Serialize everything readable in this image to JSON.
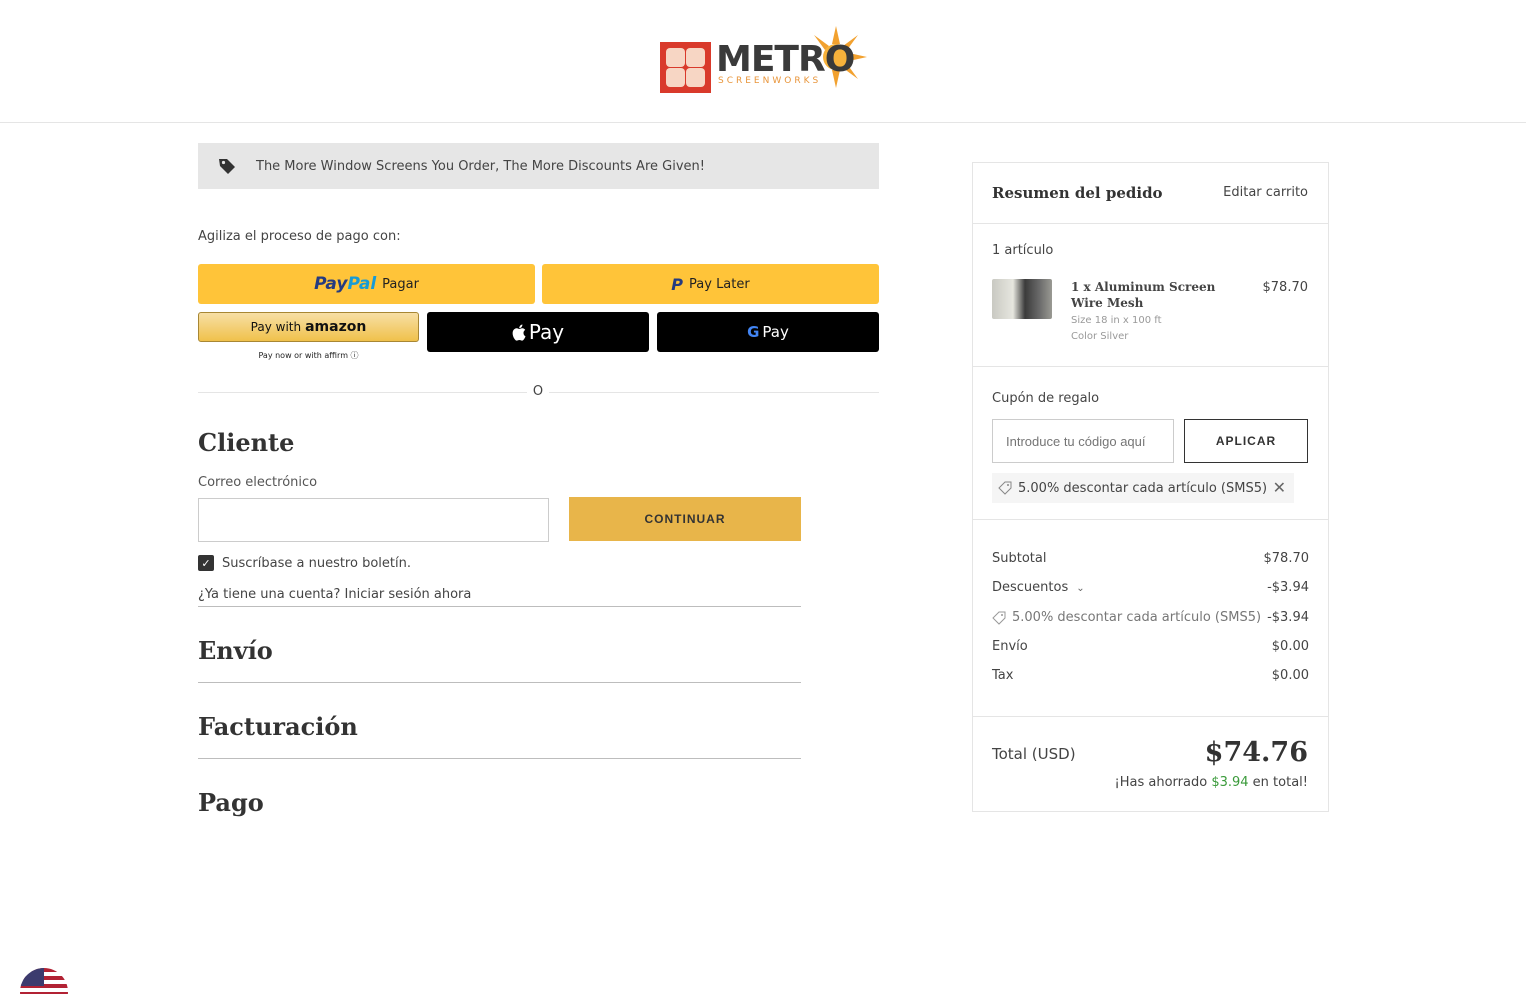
{
  "header": {
    "logo_word": "METRO",
    "logo_sub": "SCREENWORKS"
  },
  "promo": {
    "text": "The More Window Screens You Order, The More Discounts Are Given!",
    "icon": "tag-icon"
  },
  "express": {
    "label": "Agiliza el proceso de pago con:",
    "paypal_pay": "Pay",
    "paypal_pal": "Pal",
    "paypal_label": "Pagar",
    "paylater_label": "Pay Later",
    "amazon_prefix": "Pay with",
    "amazon_brand": "amazon",
    "affirm_note": "Pay now or with affirm ⓘ",
    "apple_label": "Pay",
    "gpay_g": "G",
    "gpay_label": "Pay",
    "or": "O"
  },
  "customer": {
    "title": "Cliente",
    "email_label": "Correo electrónico",
    "email_value": "",
    "continue": "CONTINUAR",
    "newsletter": "Suscríbase a nuestro boletín.",
    "newsletter_checked": true,
    "login": "¿Ya tiene una cuenta? Iniciar sesión ahora"
  },
  "sections": {
    "shipping": "Envío",
    "billing": "Facturación",
    "payment": "Pago"
  },
  "summary": {
    "title": "Resumen del pedido",
    "edit": "Editar carrito",
    "count": "1 artículo",
    "item": {
      "name": "1 x Aluminum Screen Wire Mesh",
      "price": "$78.70",
      "size": "Size 18 in x 100 ft",
      "color": "Color Silver"
    },
    "coupon": {
      "label": "Cupón de regalo",
      "placeholder": "Introduce tu código aquí",
      "apply": "APLICAR",
      "applied": "5.00% descontar cada artículo (SMS5)"
    },
    "totals": {
      "subtotal_label": "Subtotal",
      "subtotal": "$78.70",
      "discounts_label": "Descuentos",
      "discounts": "-$3.94",
      "discount_line_label": "5.00% descontar cada artículo (SMS5)",
      "discount_line": "-$3.94",
      "shipping_label": "Envío",
      "shipping": "$0.00",
      "tax_label": "Tax",
      "tax": "$0.00"
    },
    "grand": {
      "label": "Total (USD)",
      "value": "$74.76",
      "saved_prefix": "¡Has ahorrado ",
      "saved_amount": "$3.94",
      "saved_suffix": " en total!"
    }
  },
  "colors": {
    "accent": "#e8b54a",
    "paypal_yellow": "#ffc439",
    "saved_green": "#3a9a3a"
  }
}
